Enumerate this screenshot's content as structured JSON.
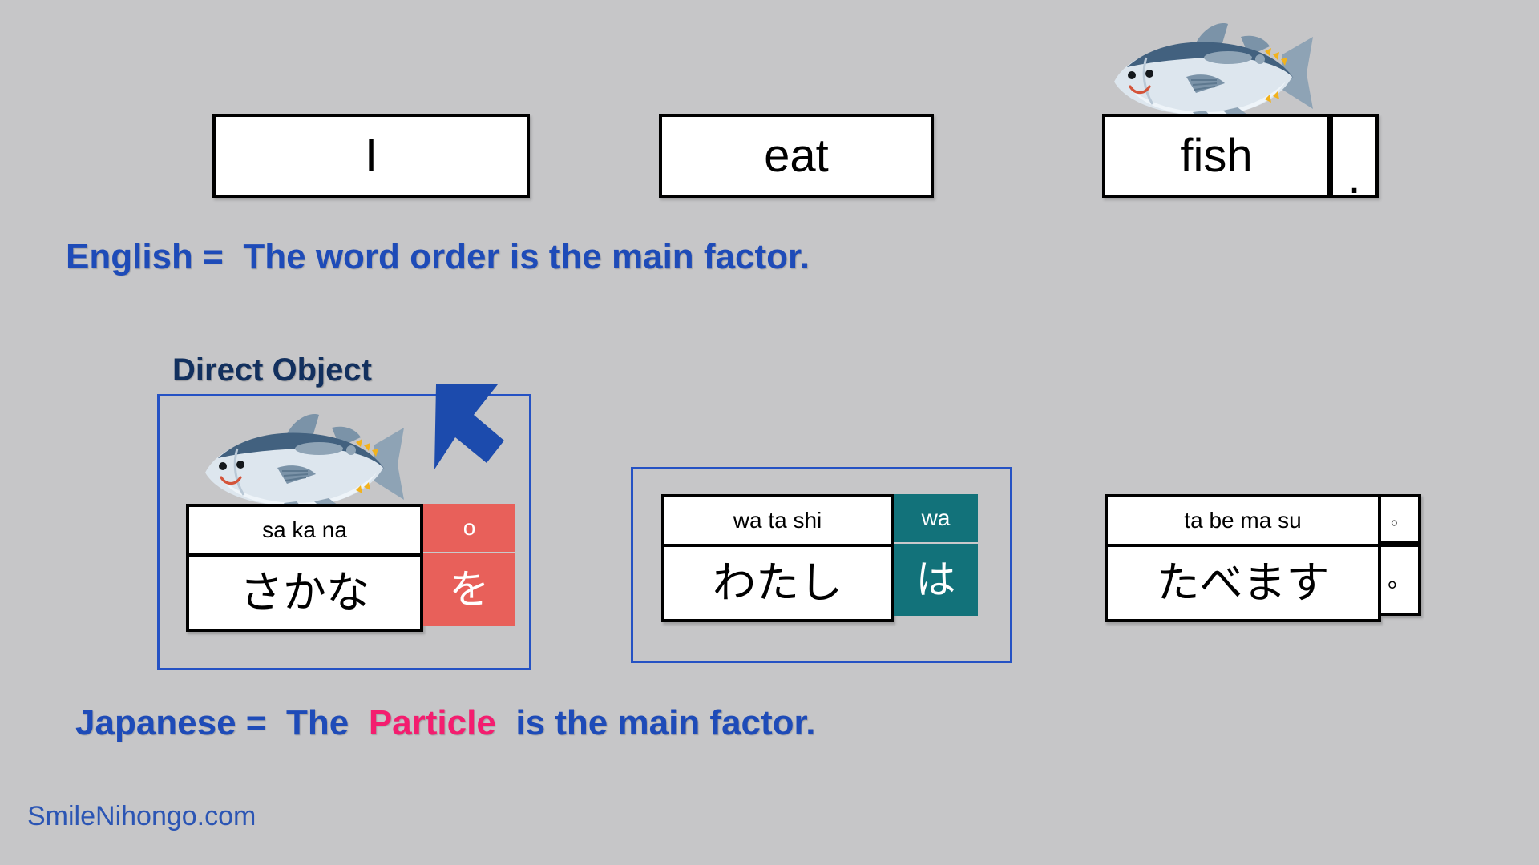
{
  "background_color": "#c6c6c8",
  "english_row": {
    "words": [
      {
        "text": "I"
      },
      {
        "text": "eat"
      },
      {
        "text": "fish"
      }
    ],
    "period": "."
  },
  "english_caption": {
    "lead": "English =",
    "rest_before": "The word order is the main factor.",
    "color": "#1e4bb8"
  },
  "direct_object_label": {
    "text": "Direct Object",
    "color": "#12305e"
  },
  "japanese_units": [
    {
      "id": "sakana",
      "romaji": "sa ka na",
      "kana": "さかな",
      "particle_romaji": "o",
      "particle_kana": "を",
      "particle_color": "#e8605a",
      "particle_style": "red"
    },
    {
      "id": "watashi",
      "romaji": "wa ta shi",
      "kana": "わたし",
      "particle_romaji": "wa",
      "particle_kana": "は",
      "particle_color": "#12727a",
      "particle_style": "teal"
    },
    {
      "id": "tabemasu",
      "romaji": "ta be ma su",
      "kana": "たべます",
      "particle_romaji": "。",
      "particle_kana": "。",
      "particle_color": "#ffffff",
      "particle_style": "plain"
    }
  ],
  "japanese_caption": {
    "lead": "Japanese =",
    "part1": "The",
    "highlight": "Particle",
    "part2": "is the main factor.",
    "color": "#1e4bb8",
    "highlight_color": "#f41d6f"
  },
  "footer": {
    "text": "SmileNihongo.com",
    "color": "#2b55b4"
  },
  "icons": {
    "fish": "fish-illustration",
    "arrow": "arrow-down-left-icon"
  },
  "frames": {
    "border_color": "#2552c4"
  }
}
